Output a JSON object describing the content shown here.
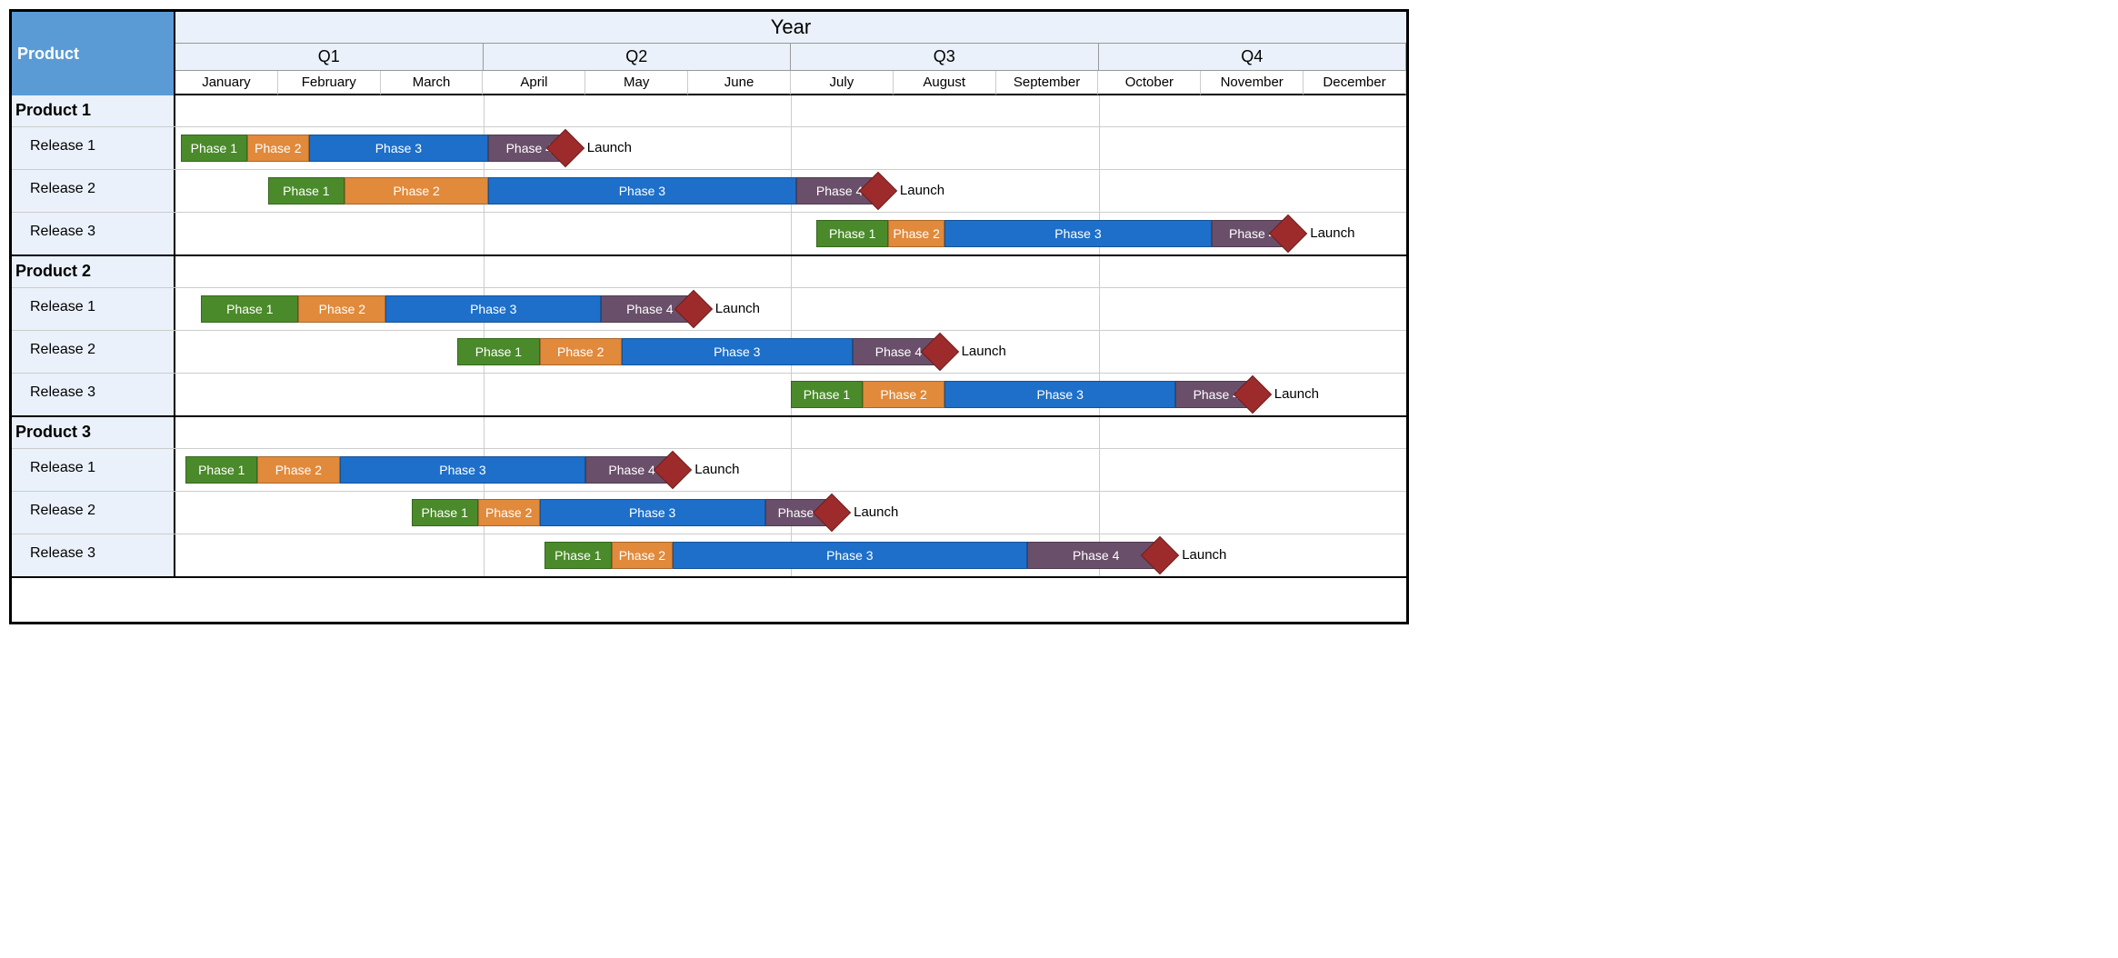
{
  "header": {
    "product_col": "Product",
    "year": "Year",
    "quarters": [
      "Q1",
      "Q2",
      "Q3",
      "Q4"
    ],
    "months": [
      "January",
      "February",
      "March",
      "April",
      "May",
      "June",
      "July",
      "August",
      "September",
      "October",
      "November",
      "December"
    ]
  },
  "colors": {
    "phase1": "#4a8a2a",
    "phase2": "#e18a3b",
    "phase3": "#1d6fc9",
    "phase4": "#6a4f6a",
    "milestone": "#9e2b2b",
    "header_bg": "#eaf1fa",
    "product_col_bg": "#5a9bd5"
  },
  "chart_data": {
    "type": "gantt",
    "x_axis": {
      "unit": "month",
      "start": 0,
      "end": 12
    },
    "legend": [
      "Phase 1",
      "Phase 2",
      "Phase 3",
      "Phase 4",
      "Launch"
    ],
    "products": [
      {
        "name": "Product 1",
        "releases": [
          {
            "name": "Release 1",
            "bars": [
              {
                "label": "Phase 1",
                "class": "phase1",
                "start": 0.05,
                "end": 0.7
              },
              {
                "label": "Phase 2",
                "class": "phase2",
                "start": 0.7,
                "end": 1.3
              },
              {
                "label": "Phase 3",
                "class": "phase3",
                "start": 1.3,
                "end": 3.05
              },
              {
                "label": "Phase 4",
                "class": "phase4",
                "start": 3.05,
                "end": 3.85
              }
            ],
            "milestone": {
              "label": "Launch",
              "at": 3.8
            }
          },
          {
            "name": "Release 2",
            "bars": [
              {
                "label": "Phase 1",
                "class": "phase1",
                "start": 0.9,
                "end": 1.65
              },
              {
                "label": "Phase 2",
                "class": "phase2",
                "start": 1.65,
                "end": 3.05
              },
              {
                "label": "Phase 3",
                "class": "phase3",
                "start": 3.05,
                "end": 6.05
              },
              {
                "label": "Phase 4",
                "class": "phase4",
                "start": 6.05,
                "end": 6.9
              }
            ],
            "milestone": {
              "label": "Launch",
              "at": 6.85
            }
          },
          {
            "name": "Release 3",
            "bars": [
              {
                "label": "Phase 1",
                "class": "phase1",
                "start": 6.25,
                "end": 6.95
              },
              {
                "label": "Phase 2",
                "class": "phase2",
                "start": 6.95,
                "end": 7.5
              },
              {
                "label": "Phase 3",
                "class": "phase3",
                "start": 7.5,
                "end": 10.1
              },
              {
                "label": "Phase 4",
                "class": "phase4",
                "start": 10.1,
                "end": 10.9
              }
            ],
            "milestone": {
              "label": "Launch",
              "at": 10.85
            }
          }
        ]
      },
      {
        "name": "Product 2",
        "releases": [
          {
            "name": "Release 1",
            "bars": [
              {
                "label": "Phase 1",
                "class": "phase1",
                "start": 0.25,
                "end": 1.2
              },
              {
                "label": "Phase 2",
                "class": "phase2",
                "start": 1.2,
                "end": 2.05
              },
              {
                "label": "Phase 3",
                "class": "phase3",
                "start": 2.05,
                "end": 4.15
              },
              {
                "label": "Phase 4",
                "class": "phase4",
                "start": 4.15,
                "end": 5.1
              }
            ],
            "milestone": {
              "label": "Launch",
              "at": 5.05
            }
          },
          {
            "name": "Release 2",
            "bars": [
              {
                "label": "Phase 1",
                "class": "phase1",
                "start": 2.75,
                "end": 3.55
              },
              {
                "label": "Phase 2",
                "class": "phase2",
                "start": 3.55,
                "end": 4.35
              },
              {
                "label": "Phase 3",
                "class": "phase3",
                "start": 4.35,
                "end": 6.6
              },
              {
                "label": "Phase 4",
                "class": "phase4",
                "start": 6.6,
                "end": 7.5
              }
            ],
            "milestone": {
              "label": "Launch",
              "at": 7.45
            }
          },
          {
            "name": "Release 3",
            "bars": [
              {
                "label": "Phase 1",
                "class": "phase1",
                "start": 6.0,
                "end": 6.7
              },
              {
                "label": "Phase 2",
                "class": "phase2",
                "start": 6.7,
                "end": 7.5
              },
              {
                "label": "Phase 3",
                "class": "phase3",
                "start": 7.5,
                "end": 9.75
              },
              {
                "label": "Phase 4",
                "class": "phase4",
                "start": 9.75,
                "end": 10.55
              }
            ],
            "milestone": {
              "label": "Launch",
              "at": 10.5
            }
          }
        ]
      },
      {
        "name": "Product 3",
        "releases": [
          {
            "name": "Release 1",
            "bars": [
              {
                "label": "Phase 1",
                "class": "phase1",
                "start": 0.1,
                "end": 0.8
              },
              {
                "label": "Phase 2",
                "class": "phase2",
                "start": 0.8,
                "end": 1.6
              },
              {
                "label": "Phase 3",
                "class": "phase3",
                "start": 1.6,
                "end": 4.0
              },
              {
                "label": "Phase 4",
                "class": "phase4",
                "start": 4.0,
                "end": 4.9
              }
            ],
            "milestone": {
              "label": "Launch",
              "at": 4.85
            }
          },
          {
            "name": "Release 2",
            "bars": [
              {
                "label": "Phase 1",
                "class": "phase1",
                "start": 2.3,
                "end": 2.95
              },
              {
                "label": "Phase 2",
                "class": "phase2",
                "start": 2.95,
                "end": 3.55
              },
              {
                "label": "Phase 3",
                "class": "phase3",
                "start": 3.55,
                "end": 5.75
              },
              {
                "label": "Phase 4",
                "class": "phase4",
                "start": 5.75,
                "end": 6.45
              }
            ],
            "milestone": {
              "label": "Launch",
              "at": 6.4
            }
          },
          {
            "name": "Release 3",
            "bars": [
              {
                "label": "Phase 1",
                "class": "phase1",
                "start": 3.6,
                "end": 4.25
              },
              {
                "label": "Phase 2",
                "class": "phase2",
                "start": 4.25,
                "end": 4.85
              },
              {
                "label": "Phase 3",
                "class": "phase3",
                "start": 4.85,
                "end": 8.3
              },
              {
                "label": "Phase 4",
                "class": "phase4",
                "start": 8.3,
                "end": 9.65
              }
            ],
            "milestone": {
              "label": "Launch",
              "at": 9.6
            }
          }
        ]
      }
    ]
  }
}
